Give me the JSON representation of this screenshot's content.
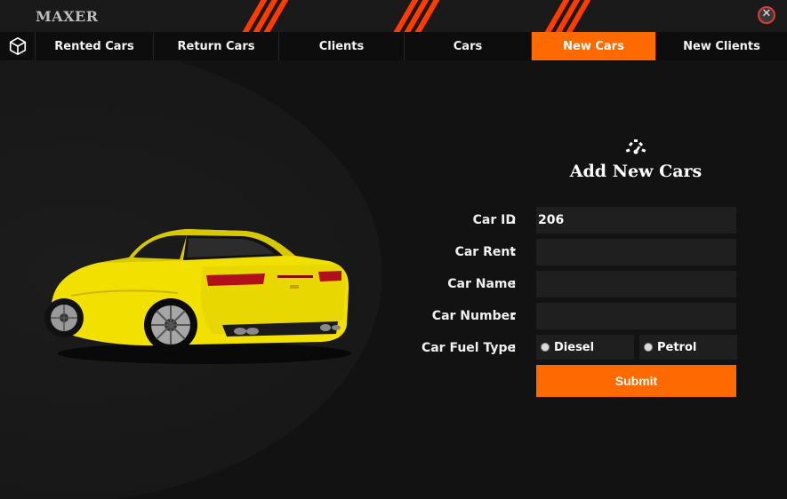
{
  "app": {
    "title": "MAXER"
  },
  "nav": {
    "tabs": [
      {
        "label": "Rented Cars"
      },
      {
        "label": "Return Cars"
      },
      {
        "label": "Clients"
      },
      {
        "label": "Cars"
      },
      {
        "label": "New Cars",
        "active": true
      },
      {
        "label": "New Clients"
      }
    ]
  },
  "form": {
    "title": "Add New Cars",
    "fields": [
      {
        "label": "Car ID",
        "value": "206"
      },
      {
        "label": "Car Rent",
        "value": ""
      },
      {
        "label": "Car Name",
        "value": ""
      },
      {
        "label": "Car Number",
        "value": ""
      }
    ],
    "fuel": {
      "label": "Car Fuel Type",
      "options": [
        "Diesel",
        "Petrol"
      ]
    },
    "colon": ":",
    "submit_label": "Submit"
  },
  "colors": {
    "accent": "#ff6a00",
    "stripe": "#ff3b00",
    "car_body": "#f2e000",
    "background": "#121212"
  },
  "icons": {
    "nav": "cube-icon",
    "form": "gauge-icon",
    "close": "close-icon"
  }
}
